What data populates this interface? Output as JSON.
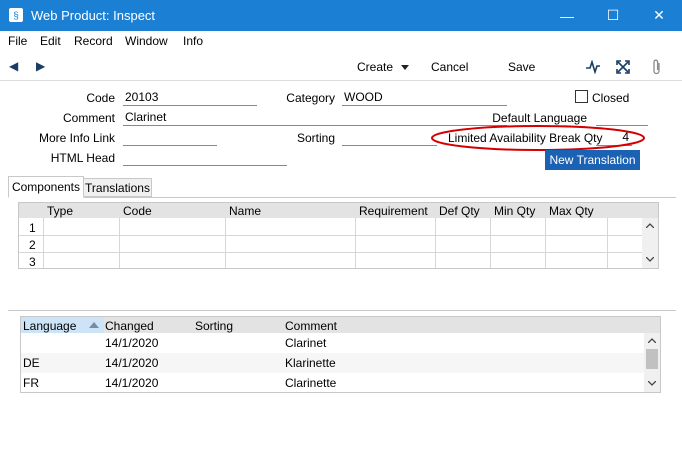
{
  "window": {
    "title": "Web Product: Inspect",
    "minimize": "—",
    "maximize": "☐",
    "close": "✕"
  },
  "menu": [
    "File",
    "Edit",
    "Record",
    "Window",
    "Info"
  ],
  "toolbar": {
    "prev": "◀",
    "next": "▶",
    "create": "Create",
    "cancel": "Cancel",
    "save": "Save",
    "pulse_icon": "∿",
    "expand_icon": "⤢",
    "attach_icon": "📎"
  },
  "form": {
    "code_label": "Code",
    "code_value": "20103",
    "category_label": "Category",
    "category_value": "WOOD",
    "closed_label": "Closed",
    "comment_label": "Comment",
    "comment_value": "Clarinet",
    "default_language_label": "Default Language",
    "default_language_value": "",
    "more_info_label": "More Info Link",
    "more_info_value": "",
    "sorting_label": "Sorting",
    "sorting_value": "",
    "lab_label": "Limited Availability Break Qty",
    "lab_value": "4",
    "html_head_label": "HTML Head",
    "html_head_value": "",
    "new_translation": "New Translation",
    "highlight_color": "#d40000"
  },
  "tabs": [
    "Components",
    "Translations"
  ],
  "components": {
    "headers": [
      "Type",
      "Code",
      "Name",
      "Requirement",
      "Def Qty",
      "Min Qty",
      "Max Qty"
    ],
    "row_numbers": [
      "1",
      "2",
      "3"
    ]
  },
  "translations": {
    "headers": [
      "Language",
      "Changed",
      "Sorting",
      "Comment"
    ],
    "rows": [
      {
        "language": "",
        "changed": "14/1/2020",
        "sorting": "",
        "comment": "Clarinet"
      },
      {
        "language": "DE",
        "changed": "14/1/2020",
        "sorting": "",
        "comment": "Klarinette"
      },
      {
        "language": "FR",
        "changed": "14/1/2020",
        "sorting": "",
        "comment": "Clarinette"
      }
    ]
  }
}
